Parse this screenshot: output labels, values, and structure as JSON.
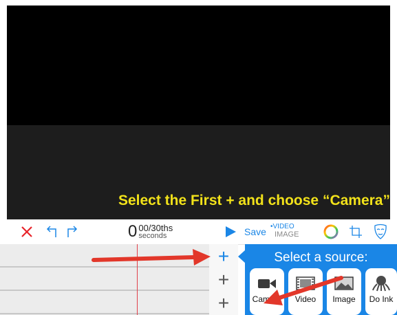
{
  "instruction_caption": "Select the First + and choose “Camera”",
  "toolbar": {
    "close_icon": "x-icon",
    "undo_icon": "undo-icon",
    "redo_icon": "redo-icon",
    "timecode_seconds": "0",
    "timecode_fraction": "00/30ths",
    "timecode_unit": "seconds",
    "play_icon": "play-icon",
    "save_label": "Save",
    "mode_video": "•VIDEO",
    "mode_image": "IMAGE",
    "color_wheel_icon": "color-wheel-icon",
    "crop_icon": "crop-icon",
    "mask_icon": "mask-icon"
  },
  "timeline": {
    "tracks": 3,
    "add_buttons": [
      "+",
      "+",
      "+"
    ]
  },
  "source_panel": {
    "title": "Select a source:",
    "options": [
      {
        "label": "Camera",
        "icon": "camera-icon"
      },
      {
        "label": "Video",
        "icon": "film-icon"
      },
      {
        "label": "Image",
        "icon": "image-icon"
      },
      {
        "label": "Do Ink",
        "icon": "octopus-icon"
      }
    ]
  },
  "colors": {
    "accent": "#1a86e6",
    "close_red": "#e8232a",
    "caption_yellow": "#f2e21a",
    "arrow_red": "#e2372a"
  }
}
